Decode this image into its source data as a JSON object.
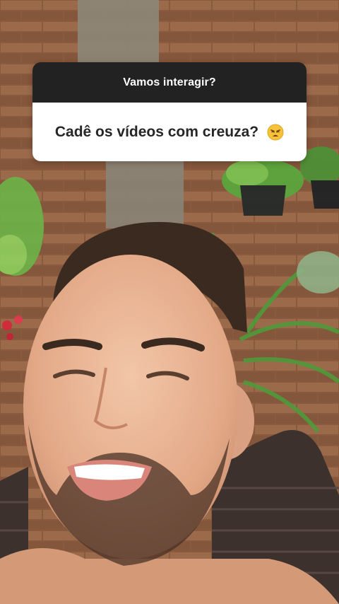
{
  "question_sticker": {
    "prompt": "Vamos interagir?",
    "answer": "Cadê os vídeos com creuza?",
    "emoji": "weary-face-emoji"
  },
  "colors": {
    "sticker_header": "#222222",
    "sticker_body": "#ffffff",
    "answer_text": "#262626",
    "wall_brick": "#8a5a3e",
    "plant_green": "#4f9a3a",
    "skin": "#e8b697",
    "hair": "#3b2a20",
    "chair": "#3d312d"
  }
}
